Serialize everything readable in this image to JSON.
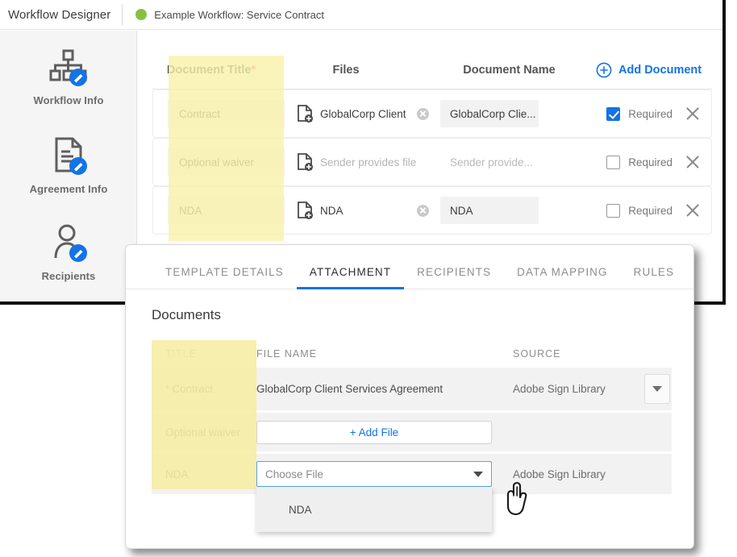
{
  "header": {
    "app_title": "Workflow Designer",
    "workflow_name": "Example Workflow: Service Contract",
    "status_dot_color": "#87c040"
  },
  "sidebar": {
    "items": [
      {
        "label": "Workflow Info",
        "icon": "workflow-org-chart-icon"
      },
      {
        "label": "Agreement Info",
        "icon": "document-edit-icon"
      },
      {
        "label": "Recipients",
        "icon": "person-edit-icon"
      }
    ]
  },
  "document_table": {
    "columns": {
      "title": "Document Title",
      "title_required_marker": "*",
      "files": "Files",
      "document_name": "Document Name",
      "add_document": "Add Document"
    },
    "rows": [
      {
        "title": "Contract",
        "file": "GlobalCorp Client",
        "file_muted": false,
        "has_clear": true,
        "document_name": "GlobalCorp Clie...",
        "name_muted": false,
        "required_label": "Required",
        "required_checked": true
      },
      {
        "title": "Optional waiver",
        "file": "Sender provides file",
        "file_muted": true,
        "has_clear": false,
        "document_name": "Sender provide...",
        "name_muted": true,
        "required_label": "Required",
        "required_checked": false
      },
      {
        "title": "NDA",
        "file": "NDA",
        "file_muted": false,
        "has_clear": true,
        "document_name": "NDA",
        "name_muted": false,
        "required_label": "Required",
        "required_checked": false
      }
    ]
  },
  "dialog": {
    "tabs": [
      {
        "label": "TEMPLATE DETAILS",
        "active": false
      },
      {
        "label": "ATTACHMENT",
        "active": true
      },
      {
        "label": "RECIPIENTS",
        "active": false
      },
      {
        "label": "DATA MAPPING",
        "active": false
      },
      {
        "label": "RULES",
        "active": false
      }
    ],
    "section_title": "Documents",
    "columns": {
      "title": "TITLE",
      "file_name": "FILE NAME",
      "source": "SOURCE"
    },
    "rows": [
      {
        "title": "Contract",
        "required_marker": "*",
        "file_name": "GlobalCorp Client Services Agreement",
        "source": "Adobe Sign Library"
      },
      {
        "title": "Optional waiver",
        "required_marker": "",
        "add_file_label": "+ Add File",
        "source": ""
      },
      {
        "title": "NDA",
        "required_marker": "",
        "choose_file_placeholder": "Choose File",
        "dropdown_option": "NDA",
        "source": "Adobe Sign Library"
      }
    ]
  },
  "colors": {
    "accent_blue": "#1473e6",
    "highlight_yellow": "#faf2ab",
    "required_red": "#e34850",
    "status_green": "#87c040"
  }
}
